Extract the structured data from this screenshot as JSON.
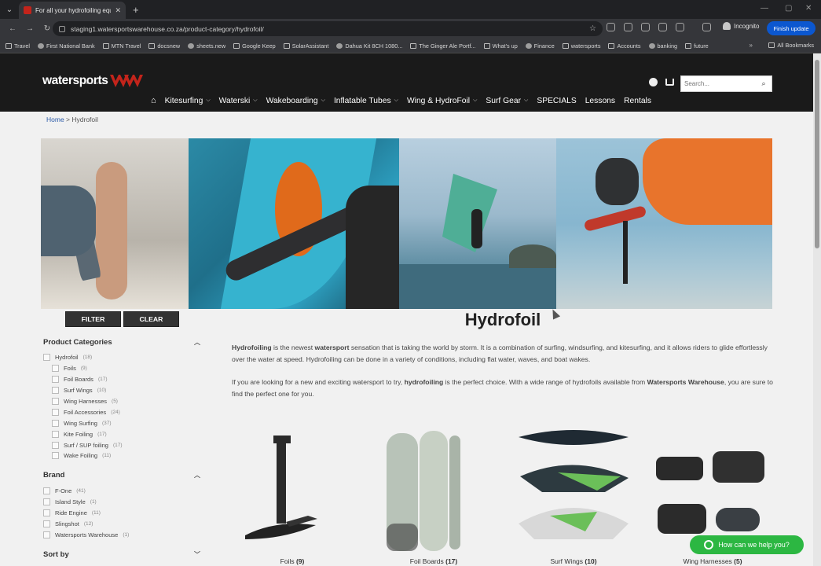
{
  "browser": {
    "tab_title": "For all your hydrofoiling equip",
    "url": "staging1.watersportswarehouse.co.za/product-category/hydrofoil/",
    "profile": "Incognito",
    "update_button": "Finish update",
    "bookmarks": [
      "Travel",
      "First National Bank",
      "MTN Travel",
      "docsnew",
      "sheets.new",
      "Google Keep",
      "SolarAssistant",
      "Dahua Kit 8CH 1080...",
      "The Ginger Ale Portf...",
      "What's up",
      "Finance",
      "watersports",
      "Accounts",
      "banking",
      "future"
    ],
    "all_bookmarks": "All Bookmarks"
  },
  "site": {
    "logo": "watersports",
    "logo_sub": "WAREHOUSE",
    "search_placeholder": "Search...",
    "nav": [
      {
        "label": "Kitesurfing",
        "chevron": true
      },
      {
        "label": "Waterski",
        "chevron": true
      },
      {
        "label": "Wakeboarding",
        "chevron": true
      },
      {
        "label": "Inflatable Tubes",
        "chevron": true
      },
      {
        "label": "Wing & HydroFoil",
        "chevron": true
      },
      {
        "label": "Surf Gear",
        "chevron": true
      },
      {
        "label": "SPECIALS",
        "chevron": false
      },
      {
        "label": "Lessons",
        "chevron": false
      },
      {
        "label": "Rentals",
        "chevron": false
      }
    ],
    "accent": "#c3241b"
  },
  "breadcrumb": {
    "home": "Home",
    "sep": " > ",
    "current": "Hydrofoil"
  },
  "filters": {
    "filter_label": "FILTER",
    "clear_label": "CLEAR"
  },
  "sidebar": {
    "categories_title": "Product Categories",
    "categories": [
      {
        "label": "Hydrofoil",
        "count": "(18)",
        "indent": false
      },
      {
        "label": "Foils",
        "count": "(9)",
        "indent": true
      },
      {
        "label": "Foil Boards",
        "count": "(17)",
        "indent": true
      },
      {
        "label": "Surf Wings",
        "count": "(10)",
        "indent": true
      },
      {
        "label": "Wing Harnesses",
        "count": "(5)",
        "indent": true
      },
      {
        "label": "Foil Accessories",
        "count": "(24)",
        "indent": true
      },
      {
        "label": "Wing Surfing",
        "count": "(37)",
        "indent": true
      },
      {
        "label": "Kite Foiling",
        "count": "(17)",
        "indent": true
      },
      {
        "label": "Surf / SUP foiling",
        "count": "(17)",
        "indent": true
      },
      {
        "label": "Wake Foiling",
        "count": "(11)",
        "indent": true
      }
    ],
    "brand_title": "Brand",
    "brands": [
      {
        "label": "F-One",
        "count": "(41)"
      },
      {
        "label": "Island Style",
        "count": "(1)"
      },
      {
        "label": "Ride Engine",
        "count": "(11)"
      },
      {
        "label": "Slingshot",
        "count": "(12)"
      },
      {
        "label": "Watersports Warehouse",
        "count": "(1)"
      }
    ],
    "sort_title": "Sort by"
  },
  "content": {
    "title": "Hydrofoil",
    "paragraph1": [
      {
        "t": "Hydrofoiling",
        "b": true
      },
      {
        "t": " is the newest ",
        "b": false
      },
      {
        "t": "watersport",
        "b": true
      },
      {
        "t": " sensation that is taking the world by storm. It is a combination of surfing, windsurfing, and kitesurfing, and it allows riders to glide effortlessly over the water at speed. Hydrofoiling can be done in a variety of conditions, including flat water, waves, and boat wakes.",
        "b": false
      }
    ],
    "paragraph2": [
      {
        "t": "If you are looking for a new and exciting watersport to try, ",
        "b": false
      },
      {
        "t": "hydrofoiling",
        "b": true
      },
      {
        "t": " is the perfect choice. With a wide range of hydrofoils available from ",
        "b": false
      },
      {
        "t": "Watersports Warehouse",
        "b": true
      },
      {
        "t": ", you are sure to find the perfect one for you.",
        "b": false
      }
    ]
  },
  "products": [
    {
      "name": "Foils",
      "count": "(9)"
    },
    {
      "name": "Foil Boards",
      "count": "(17)"
    },
    {
      "name": "Surf Wings",
      "count": "(10)"
    },
    {
      "name": "Wing Harnesses",
      "count": "(5)"
    }
  ],
  "whatsapp": {
    "label": "How can we help you?",
    "color": "#2cb742"
  }
}
